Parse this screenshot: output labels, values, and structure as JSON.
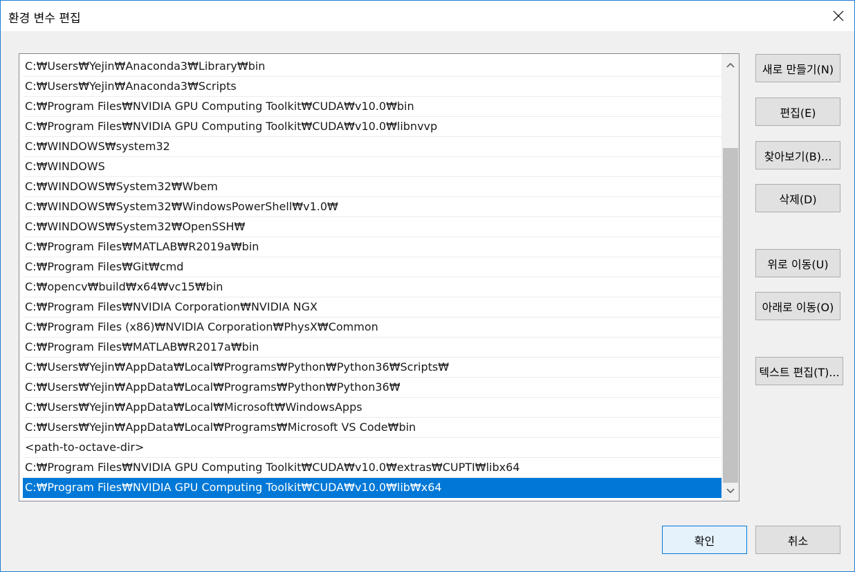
{
  "window": {
    "title": "환경 변수 편집"
  },
  "titlebar": {
    "close_icon": "close-icon"
  },
  "path_list": {
    "items": [
      "C:₩Users₩Yejin₩Anaconda3₩Library₩bin",
      "C:₩Users₩Yejin₩Anaconda3₩Scripts",
      "C:₩Program Files₩NVIDIA GPU Computing Toolkit₩CUDA₩v10.0₩bin",
      "C:₩Program Files₩NVIDIA GPU Computing Toolkit₩CUDA₩v10.0₩libnvvp",
      "C:₩WINDOWS₩system32",
      "C:₩WINDOWS",
      "C:₩WINDOWS₩System32₩Wbem",
      "C:₩WINDOWS₩System32₩WindowsPowerShell₩v1.0₩",
      "C:₩WINDOWS₩System32₩OpenSSH₩",
      "C:₩Program Files₩MATLAB₩R2019a₩bin",
      "C:₩Program Files₩Git₩cmd",
      "C:₩opencv₩build₩x64₩vc15₩bin",
      "C:₩Program Files₩NVIDIA Corporation₩NVIDIA NGX",
      "C:₩Program Files (x86)₩NVIDIA Corporation₩PhysX₩Common",
      "C:₩Program Files₩MATLAB₩R2017a₩bin",
      "C:₩Users₩Yejin₩AppData₩Local₩Programs₩Python₩Python36₩Scripts₩",
      "C:₩Users₩Yejin₩AppData₩Local₩Programs₩Python₩Python36₩",
      "C:₩Users₩Yejin₩AppData₩Local₩Microsoft₩WindowsApps",
      "C:₩Users₩Yejin₩AppData₩Local₩Programs₩Microsoft VS Code₩bin",
      "<path-to-octave-dir>",
      "C:₩Program Files₩NVIDIA GPU Computing Toolkit₩CUDA₩v10.0₩extras₩CUPTI₩libx64",
      "C:₩Program Files₩NVIDIA GPU Computing Toolkit₩CUDA₩v10.0₩lib₩x64"
    ],
    "selected_index": 21
  },
  "side_buttons": {
    "new": "새로 만들기(N)",
    "edit": "편집(E)",
    "browse": "찾아보기(B)...",
    "delete": "삭제(D)",
    "move_up": "위로 이동(U)",
    "move_down": "아래로 이동(O)",
    "edit_text": "텍스트 편집(T)..."
  },
  "footer": {
    "ok": "확인",
    "cancel": "취소"
  },
  "colors": {
    "selection": "#0078d7",
    "window_border": "#1e7bd6"
  }
}
